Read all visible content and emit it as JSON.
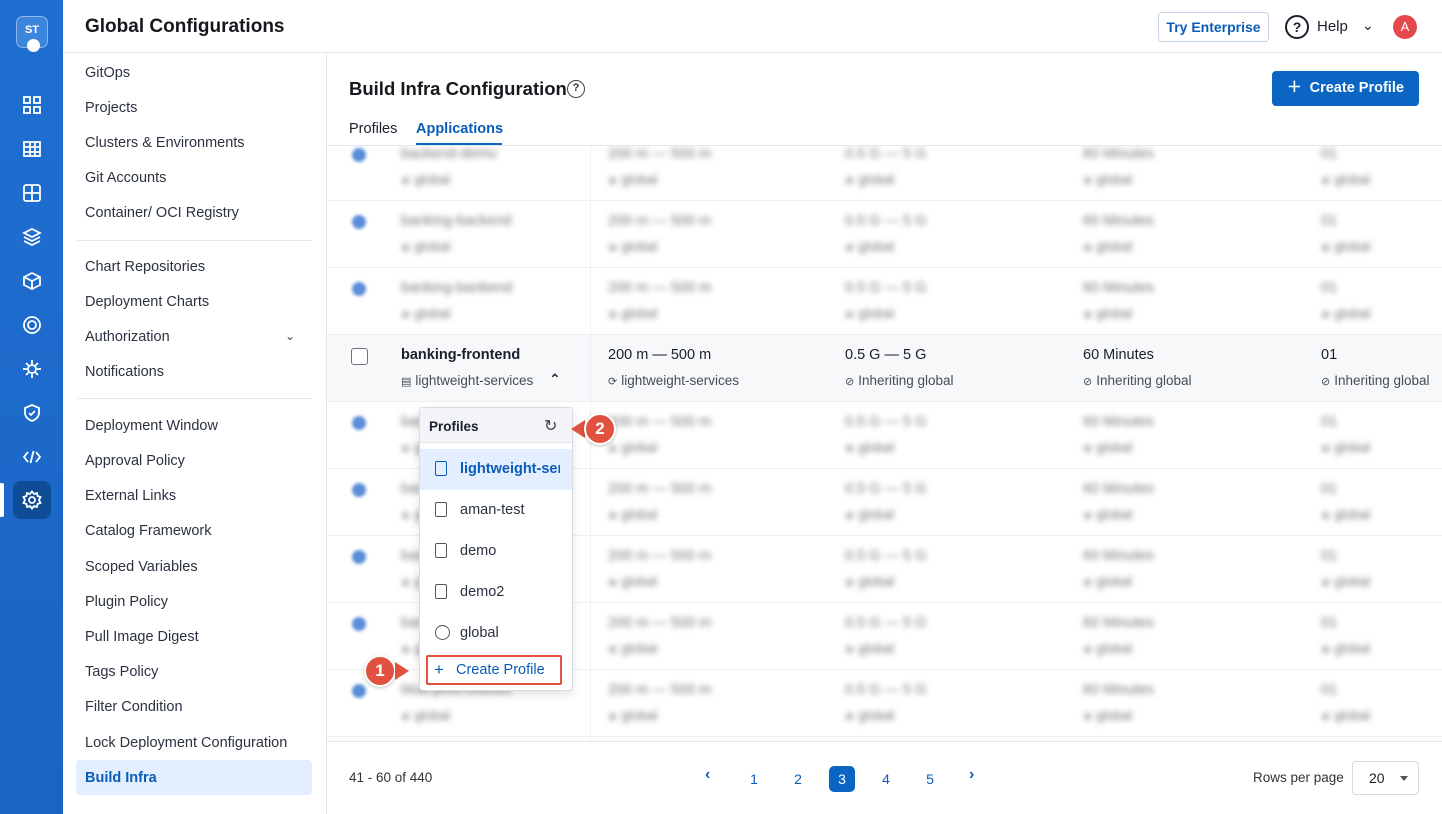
{
  "app": {
    "logo_text": "ST",
    "title": "Global Configurations"
  },
  "header": {
    "try_enterprise": "Try Enterprise",
    "help": "Help",
    "avatar_initial": "A"
  },
  "sidebar": {
    "items": [
      "GitOps",
      "Projects",
      "Clusters & Environments",
      "Git Accounts",
      "Container/ OCI Registry",
      "Chart Repositories",
      "Deployment Charts",
      "Authorization",
      "Notifications",
      "Deployment Window",
      "Approval Policy",
      "External Links",
      "Catalog Framework",
      "Scoped Variables",
      "Plugin Policy",
      "Pull Image Digest",
      "Tags Policy",
      "Filter Condition",
      "Lock Deployment Configuration",
      "Build Infra"
    ],
    "active": "Build Infra"
  },
  "page": {
    "title": "Build Infra Configuration",
    "create_button": "Create Profile",
    "help_glyph": "?"
  },
  "tabs": {
    "profiles": "Profiles",
    "applications": "Applications",
    "active": "Applications"
  },
  "rows": [
    {
      "name": "backend-demo",
      "profile": "global",
      "cpu": "200 m — 500 m",
      "cpu_src": "global",
      "mem": "0.5 G — 5 G",
      "mem_src": "global",
      "timeout": "60 Minutes",
      "timeout_src": "global",
      "nodes": "01",
      "nodes_src": "global",
      "blurred": true
    },
    {
      "name": "banking-backend",
      "profile": "global",
      "cpu": "200 m — 500 m",
      "cpu_src": "global",
      "mem": "0.5 G — 5 G",
      "mem_src": "global",
      "timeout": "60 Minutes",
      "timeout_src": "global",
      "nodes": "01",
      "nodes_src": "global",
      "blurred": true
    },
    {
      "name": "banking-bankend",
      "profile": "global",
      "cpu": "200 m — 500 m",
      "cpu_src": "global",
      "mem": "0.5 G — 5 G",
      "mem_src": "global",
      "timeout": "60 Minutes",
      "timeout_src": "global",
      "nodes": "01",
      "nodes_src": "global",
      "blurred": true
    },
    {
      "name": "banking-frontend",
      "profile": "lightweight-services",
      "cpu": "200 m — 500 m",
      "cpu_src": "lightweight-services",
      "mem": "0.5 G — 5 G",
      "mem_src": "Inheriting global",
      "timeout": "60 Minutes",
      "timeout_src": "Inheriting global",
      "nodes": "01",
      "nodes_src": "Inheriting global",
      "blurred": false
    },
    {
      "name": "banking",
      "profile": "global",
      "cpu": "200 m — 500 m",
      "cpu_src": "global",
      "mem": "0.5 G — 5 G",
      "mem_src": "global",
      "timeout": "60 Minutes",
      "timeout_src": "global",
      "nodes": "01",
      "nodes_src": "global",
      "blurred": true
    },
    {
      "name": "banking",
      "profile": "global",
      "cpu": "200 m — 500 m",
      "cpu_src": "global",
      "mem": "0.5 G — 5 G",
      "mem_src": "global",
      "timeout": "60 Minutes",
      "timeout_src": "global",
      "nodes": "01",
      "nodes_src": "global",
      "blurred": true
    },
    {
      "name": "banking",
      "profile": "global",
      "cpu": "200 m — 500 m",
      "cpu_src": "global",
      "mem": "0.5 G — 5 G",
      "mem_src": "global",
      "timeout": "60 Minutes",
      "timeout_src": "global",
      "nodes": "01",
      "nodes_src": "global",
      "blurred": true
    },
    {
      "name": "banking",
      "profile": "global",
      "cpu": "200 m — 500 m",
      "cpu_src": "global",
      "mem": "0.5 G — 5 G",
      "mem_src": "global",
      "timeout": "60 Minutes",
      "timeout_src": "global",
      "nodes": "01",
      "nodes_src": "global",
      "blurred": true
    },
    {
      "name": "blue-print-checks",
      "profile": "global",
      "cpu": "200 m — 500 m",
      "cpu_src": "global",
      "mem": "0.5 G — 5 G",
      "mem_src": "global",
      "timeout": "60 Minutes",
      "timeout_src": "global",
      "nodes": "01",
      "nodes_src": "global",
      "blurred": true
    }
  ],
  "dropdown": {
    "header": "Profiles",
    "items": [
      {
        "label": "lightweight-services",
        "icon": "file-icon",
        "selected": true
      },
      {
        "label": "aman-test",
        "icon": "file-icon",
        "selected": false
      },
      {
        "label": "demo",
        "icon": "file-icon",
        "selected": false
      },
      {
        "label": "demo2",
        "icon": "file-icon",
        "selected": false
      },
      {
        "label": "global",
        "icon": "globe-icon",
        "selected": false
      }
    ],
    "create": "Create Profile"
  },
  "callouts": {
    "one": "1",
    "two": "2"
  },
  "footer": {
    "range": "41 - 60 of 440",
    "pages": [
      "1",
      "2",
      "3",
      "4",
      "5"
    ],
    "current_page": "3",
    "rows_label": "Rows per page",
    "rows_value": "20"
  },
  "colors": {
    "primary": "#0a66c2",
    "callout": "#e0523f",
    "selected_bg": "#e3efff"
  }
}
